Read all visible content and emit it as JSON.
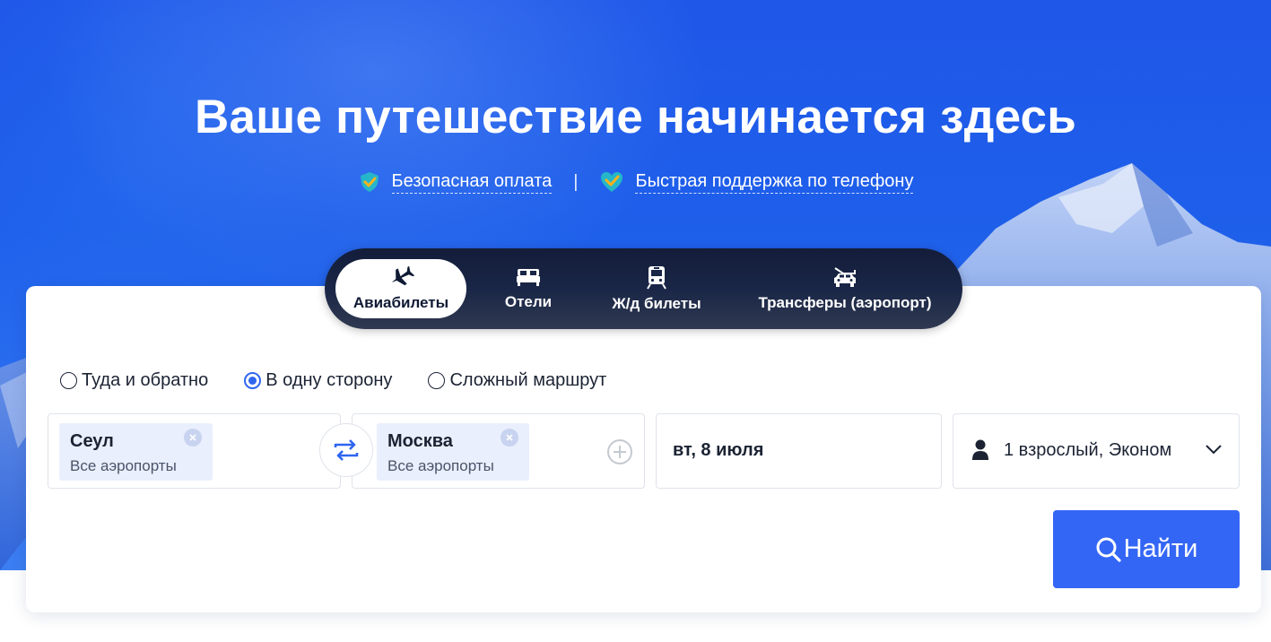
{
  "hero": {
    "title": "Ваше путешествие начинается здесь",
    "features": [
      {
        "label": "Безопасная оплата",
        "icon": "shield-check-icon"
      },
      {
        "label": "Быстрая поддержка по телефону",
        "icon": "heart-check-icon"
      }
    ],
    "separator": "|"
  },
  "tabs": [
    {
      "label": "Авиабилеты",
      "icon": "plane-icon",
      "active": true
    },
    {
      "label": "Отели",
      "icon": "bed-icon",
      "active": false
    },
    {
      "label": "Ж/д билеты",
      "icon": "train-icon",
      "active": false
    },
    {
      "label": "Трансферы (аэропорт)",
      "icon": "car-transfer-icon",
      "active": false
    }
  ],
  "trip_types": [
    {
      "label": "Туда и обратно",
      "checked": false
    },
    {
      "label": "В одну сторону",
      "checked": true
    },
    {
      "label": "Сложный маршрут",
      "checked": false
    }
  ],
  "from": {
    "city": "Сеул",
    "sub": "Все аэропорты"
  },
  "to": {
    "city": "Москва",
    "sub": "Все аэропорты"
  },
  "date": {
    "value": "вт, 8 июля"
  },
  "passengers": {
    "value": "1 взрослый, Эконом"
  },
  "search": {
    "label": "Найти"
  },
  "colors": {
    "accent": "#3466f6",
    "hero": "#1f57e8",
    "tabs_bg": "#131d3a",
    "chip_bg": "#e9effd"
  }
}
